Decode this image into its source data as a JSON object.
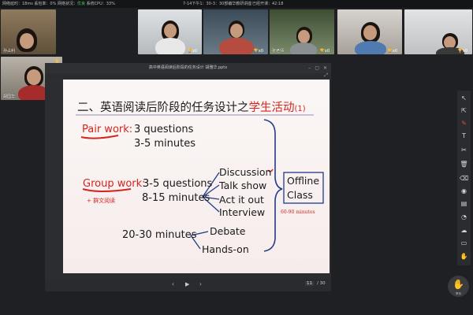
{
  "status": {
    "left": "网络延时：18ms 丢包率：0% 网络状况：",
    "network_quality": "优良",
    "cpu": "系统CPU：33%",
    "center": "7-14下午1：30-3：30部编华教研讲座",
    "recording": "已经开课：42:18"
  },
  "participants": [
    {
      "name": "孙占利",
      "badge": ""
    },
    {
      "name": "",
      "badge": "x0"
    },
    {
      "name": "",
      "badge": "x0"
    },
    {
      "name": "张老师",
      "badge": "x0"
    },
    {
      "name": "",
      "badge": "x0"
    },
    {
      "name": "",
      "badge": "x0"
    },
    {
      "name": "",
      "badge": "x0"
    }
  ],
  "host": {
    "name": "胡国华",
    "badge": "x0"
  },
  "presentation": {
    "window_title": "高中英语阅读后阶段的任务设计 胡雅华.pptx",
    "page_current": "11",
    "page_total": "/ 30"
  },
  "slide": {
    "title_prefix": "二、英语阅读后阶段的任务设计之",
    "title_highlight": "学生活动",
    "title_suffix": "(1)",
    "pair_work_label": "Pair work:",
    "pair_questions": "3 questions",
    "pair_minutes": "3-5 minutes",
    "group_work_label": "Group work:",
    "group_questions": "3-5 questions",
    "group_minutes": "8-15 minutes",
    "group_note": "+ 群文阅读",
    "activities": [
      "Discussion",
      "Talk show",
      "Act it out",
      "Interview"
    ],
    "offline_class": [
      "Offline",
      "Class"
    ],
    "offline_minutes": "60-90 minutes",
    "long_minutes": "20-30 minutes",
    "long_activities": [
      "Debate",
      "Hands-on"
    ]
  },
  "raise_hand_label": "举手"
}
